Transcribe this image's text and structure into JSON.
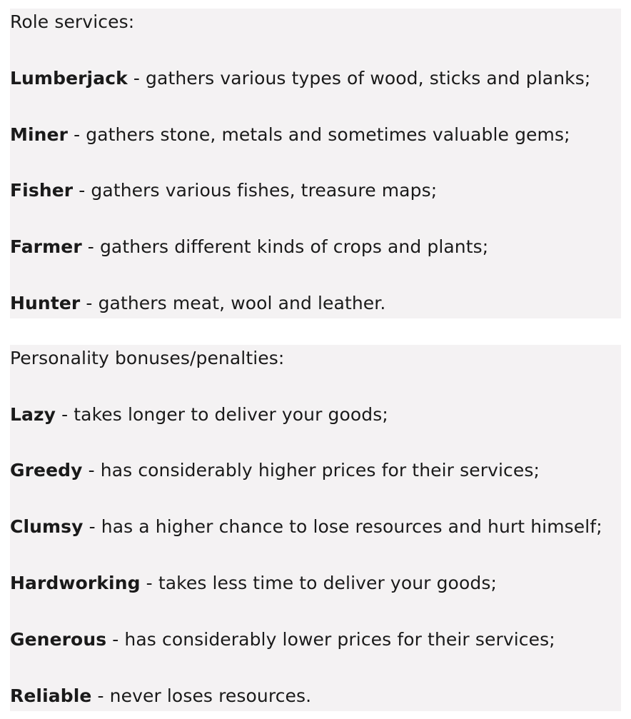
{
  "roles": {
    "heading": "Role services:",
    "items": [
      {
        "term": "Lumberjack",
        "desc": " - gathers various types of wood, sticks and planks;"
      },
      {
        "term": "Miner",
        "desc": " - gathers stone, metals and sometimes valuable gems;"
      },
      {
        "term": "Fisher",
        "desc": " - gathers various fishes, treasure maps;"
      },
      {
        "term": "Farmer",
        "desc": " - gathers different kinds of crops and plants;"
      },
      {
        "term": "Hunter",
        "desc": " - gathers meat, wool and leather."
      }
    ]
  },
  "personality": {
    "heading": "Personality bonuses/penalties:",
    "items": [
      {
        "term": "Lazy",
        "desc": " - takes longer to deliver your goods;"
      },
      {
        "term": "Greedy",
        "desc": " - has considerably higher prices for their services;"
      },
      {
        "term": "Clumsy",
        "desc": " - has a higher chance to lose resources and hurt himself;"
      },
      {
        "term": "Hardworking",
        "desc": " - takes less time to deliver your goods;"
      },
      {
        "term": "Generous",
        "desc": " - has considerably lower prices for their services;"
      },
      {
        "term": "Reliable",
        "desc": " - never loses resources."
      }
    ]
  }
}
